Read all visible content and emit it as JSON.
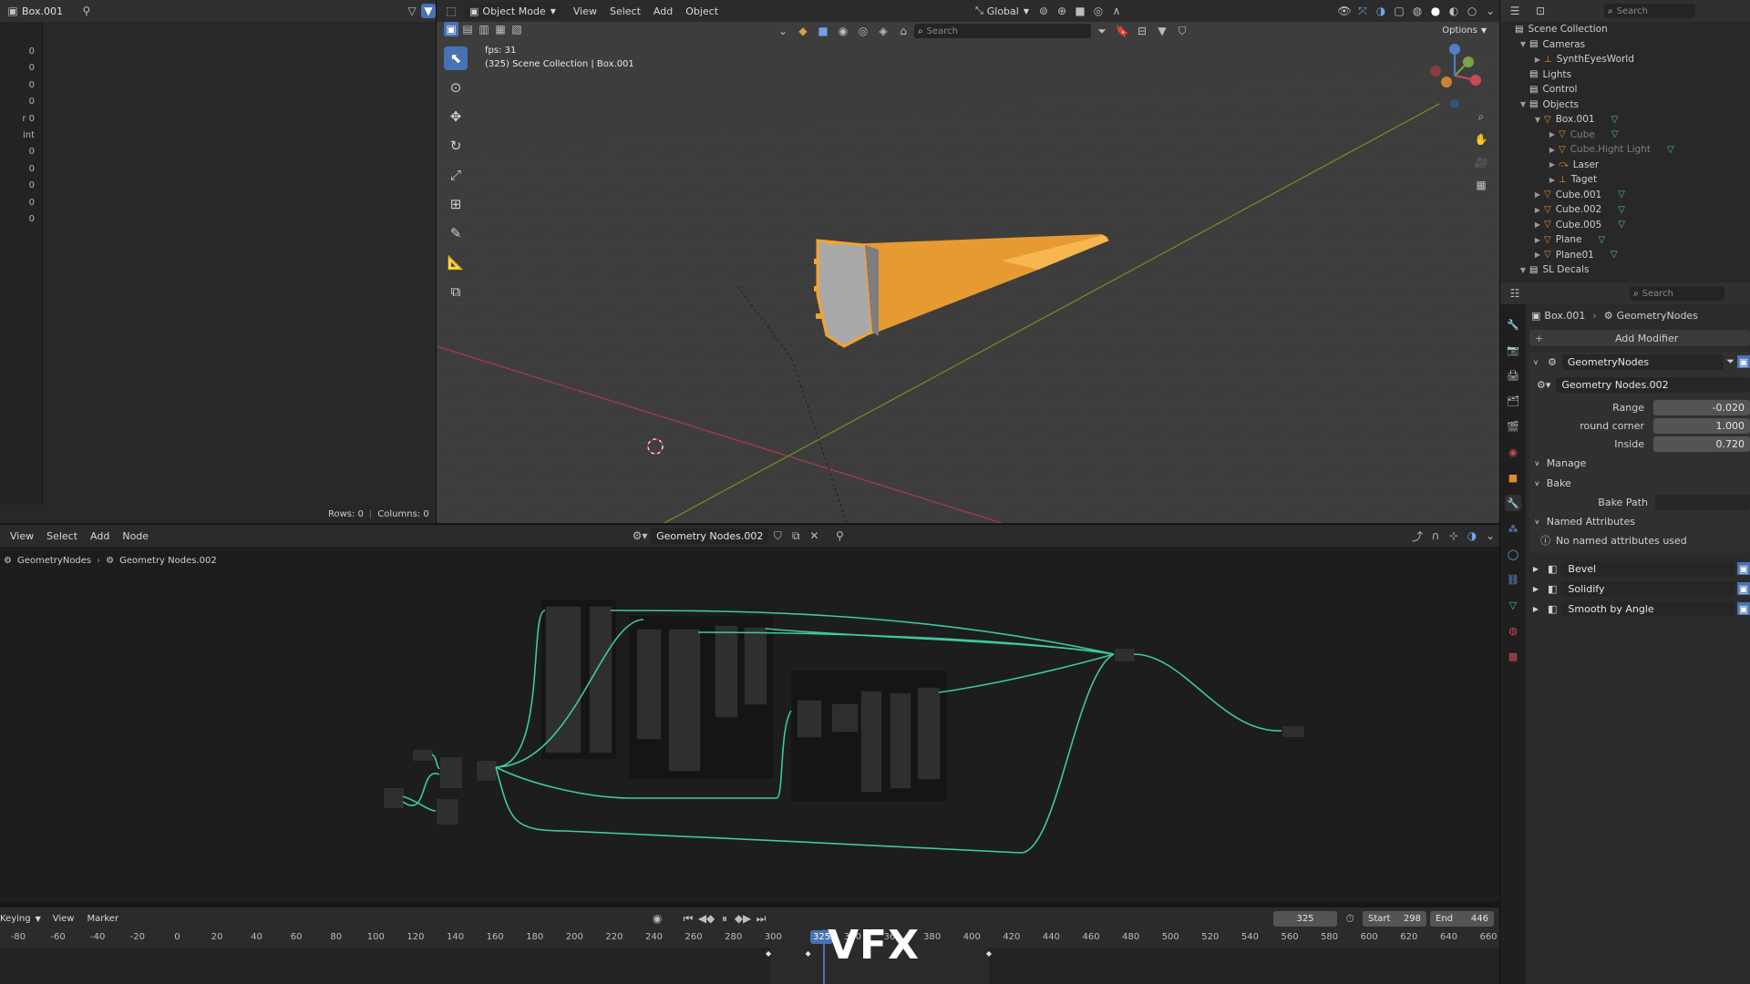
{
  "spreadsheet": {
    "object_name": "Box.001",
    "rows_label": "Rows: 0",
    "columns_label": "Columns: 0",
    "left_cut_values": [
      "0",
      "0",
      "0",
      "0",
      "r 0",
      "int",
      "0",
      "0",
      "0",
      "0",
      "0"
    ]
  },
  "viewport": {
    "mode": "Object Mode",
    "menus": [
      "View",
      "Select",
      "Add",
      "Object"
    ],
    "orientation": "Global",
    "search_placeholder": "Search",
    "options_label": "Options",
    "fps_text": "fps: 31",
    "scene_text": "(325) Scene Collection | Box.001",
    "colors": {
      "bg": "#3d3d3d",
      "grid": "#474747",
      "x_axis": "#a13b48",
      "y_axis": "#6b8e23",
      "object": "#f5a230"
    }
  },
  "outliner": {
    "search_placeholder": "Search",
    "items": [
      {
        "label": "Scene Collection",
        "indent": 0,
        "icon": "collection-icon",
        "color": "#cfcfcf",
        "expand": ""
      },
      {
        "label": "Cameras",
        "indent": 1,
        "icon": "collection-icon",
        "color": "#cfcfcf",
        "expand": "v"
      },
      {
        "label": "SynthEyesWorld",
        "indent": 2,
        "icon": "empty-icon",
        "color": "#cfcfcf",
        "expand": ">"
      },
      {
        "label": "Lights",
        "indent": 1,
        "icon": "collection-icon",
        "color": "#cfcfcf",
        "expand": ""
      },
      {
        "label": "Control",
        "indent": 1,
        "icon": "collection-icon",
        "color": "#cfcfcf",
        "expand": ""
      },
      {
        "label": "Objects",
        "indent": 1,
        "icon": "collection-icon",
        "color": "#cfcfcf",
        "expand": "v"
      },
      {
        "label": "Box.001",
        "indent": 2,
        "icon": "mesh-icon",
        "color": "#cfcfcf",
        "expand": "v"
      },
      {
        "label": "Cube",
        "indent": 3,
        "icon": "mesh-icon",
        "color": "#7d7d7d",
        "expand": ">"
      },
      {
        "label": "Cube.Hight Light",
        "indent": 3,
        "icon": "mesh-icon",
        "color": "#7d7d7d",
        "expand": ">"
      },
      {
        "label": "Laser",
        "indent": 3,
        "icon": "curve-icon",
        "color": "#cfcfcf",
        "expand": ">"
      },
      {
        "label": "Taget",
        "indent": 3,
        "icon": "empty-icon",
        "color": "#cfcfcf",
        "expand": ">"
      },
      {
        "label": "Cube.001",
        "indent": 2,
        "icon": "mesh-icon",
        "color": "#cfcfcf",
        "expand": ">"
      },
      {
        "label": "Cube.002",
        "indent": 2,
        "icon": "mesh-icon",
        "color": "#cfcfcf",
        "expand": ">"
      },
      {
        "label": "Cube.005",
        "indent": 2,
        "icon": "mesh-icon",
        "color": "#cfcfcf",
        "expand": ">"
      },
      {
        "label": "Plane",
        "indent": 2,
        "icon": "mesh-icon",
        "color": "#cfcfcf",
        "expand": ">"
      },
      {
        "label": "Plane01",
        "indent": 2,
        "icon": "mesh-icon",
        "color": "#cfcfcf",
        "expand": ">"
      },
      {
        "label": "SL Decals",
        "indent": 1,
        "icon": "collection-icon",
        "color": "#cfcfcf",
        "expand": "v"
      }
    ]
  },
  "properties": {
    "search_placeholder": "Search",
    "breadcrumb_object": "Box.001",
    "breadcrumb_modifier": "GeometryNodes",
    "add_modifier": "Add Modifier",
    "modifier_name": "GeometryNodes",
    "node_group": "Geometry Nodes.002",
    "inputs": [
      {
        "label": "Range",
        "value": "-0.020"
      },
      {
        "label": "round corner",
        "value": "1.000"
      },
      {
        "label": "Inside",
        "value": "0.720"
      }
    ],
    "manage_label": "Manage",
    "bake_label": "Bake",
    "bake_path_label": "Bake Path",
    "named_attributes_label": "Named Attributes",
    "no_named_attrs": "No named attributes used",
    "modifiers": [
      "Bevel",
      "Solidify",
      "Smooth by Angle"
    ]
  },
  "node_editor": {
    "menus": [
      "View",
      "Select",
      "Add",
      "Node"
    ],
    "group_name": "Geometry Nodes.002",
    "breadcrumb_root": "GeometryNodes",
    "breadcrumb_child": "Geometry Nodes.002",
    "wire_color": "#3fc8a4"
  },
  "timeline": {
    "keying_label": "Keying",
    "menus": [
      "View",
      "Marker"
    ],
    "current_frame": "325",
    "start_label": "Start",
    "start_value": "298",
    "end_label": "End",
    "end_value": "446",
    "ticks": [
      "-80",
      "-60",
      "-40",
      "-20",
      "0",
      "20",
      "40",
      "60",
      "80",
      "100",
      "120",
      "140",
      "160",
      "180",
      "200",
      "220",
      "240",
      "260",
      "280",
      "300",
      "3",
      "340",
      "360",
      "380",
      "400",
      "420",
      "440",
      "460",
      "480",
      "500",
      "520",
      "540",
      "560",
      "580",
      "600",
      "620",
      "640",
      "660"
    ],
    "playhead_label": "325",
    "keyframes": [
      298,
      318,
      409
    ],
    "frame_range": [
      -80,
      660
    ],
    "watermark": "VFX"
  }
}
